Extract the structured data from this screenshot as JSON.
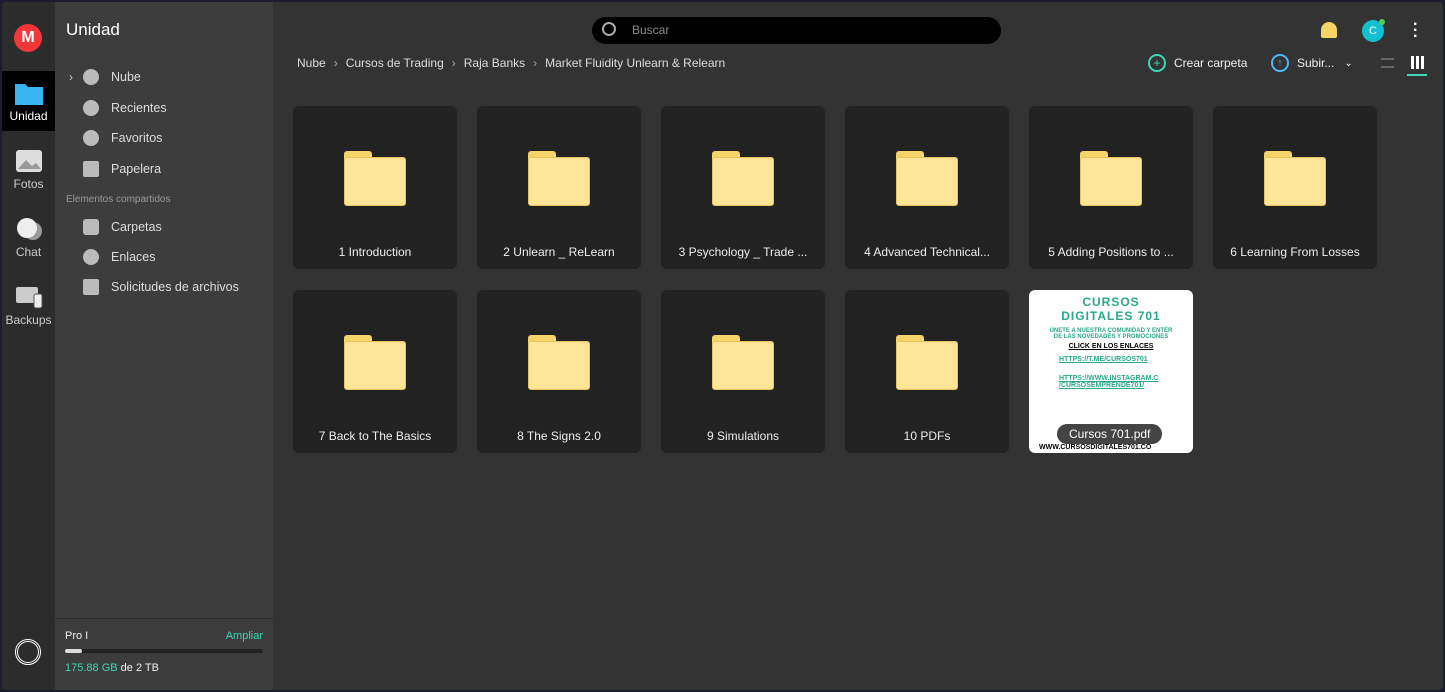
{
  "rail": {
    "items": [
      {
        "label": "Unidad",
        "icon": "folder-icon"
      },
      {
        "label": "Fotos",
        "icon": "photo-icon"
      },
      {
        "label": "Chat",
        "icon": "chat-icon"
      },
      {
        "label": "Backups",
        "icon": "devices-icon"
      }
    ]
  },
  "sidebar": {
    "title": "Unidad",
    "items": [
      {
        "label": "Nube",
        "icon": "cloud-icon"
      },
      {
        "label": "Recientes",
        "icon": "clock-icon"
      },
      {
        "label": "Favoritos",
        "icon": "heart-icon"
      },
      {
        "label": "Papelera",
        "icon": "trash-icon"
      }
    ],
    "shared_title": "Elementos compartidos",
    "shared": [
      {
        "label": "Carpetas",
        "icon": "shared-folder-icon"
      },
      {
        "label": "Enlaces",
        "icon": "link-icon"
      },
      {
        "label": "Solicitudes de archivos",
        "icon": "file-request-icon"
      }
    ],
    "storage": {
      "plan": "Pro I",
      "upgrade": "Ampliar",
      "used": "175.88 GB",
      "of": "de 2 TB",
      "fraction": 0.086
    }
  },
  "header": {
    "search_placeholder": "Buscar",
    "avatar": "C"
  },
  "breadcrumb": [
    "Nube",
    "Cursos de Trading",
    "Raja Banks",
    "Market Fluidity Unlearn & Relearn"
  ],
  "toolbar": {
    "create": "Crear carpeta",
    "upload": "Subir..."
  },
  "items": [
    "1 Introduction",
    "2 Unlearn _ ReLearn",
    "3 Psychology _ Trade ...",
    "4 Advanced Technical...",
    "5 Adding Positions to ...",
    "6 Learning From Losses",
    "7 Back to The Basics",
    "8 The Signs 2.0",
    "9 Simulations",
    "10 PDFs"
  ],
  "pdf": {
    "name": "Cursos 701.pdf",
    "l1": "CURSOS",
    "l2": "DIGITALES 701",
    "l3": "ÚNETE A NUESTRA COMUNIDAD Y ENTÉR",
    "l4": "DE LAS NOVEDADES Y PROMOCIONES",
    "l5": "CLICK EN LOS ENLACES",
    "l6": "HTTPS://T.ME/CURSOS701",
    "l7": "HTTPS://WWW.INSTAGRAM.C",
    "l8": "/CURSOSEMPRENDE701/",
    "l9": "WWW.CURSOSDIGITALES701.CO"
  },
  "colors": {
    "accent": "#3ed6b6",
    "logo": "#f0373a",
    "folder": "#fde69a"
  }
}
